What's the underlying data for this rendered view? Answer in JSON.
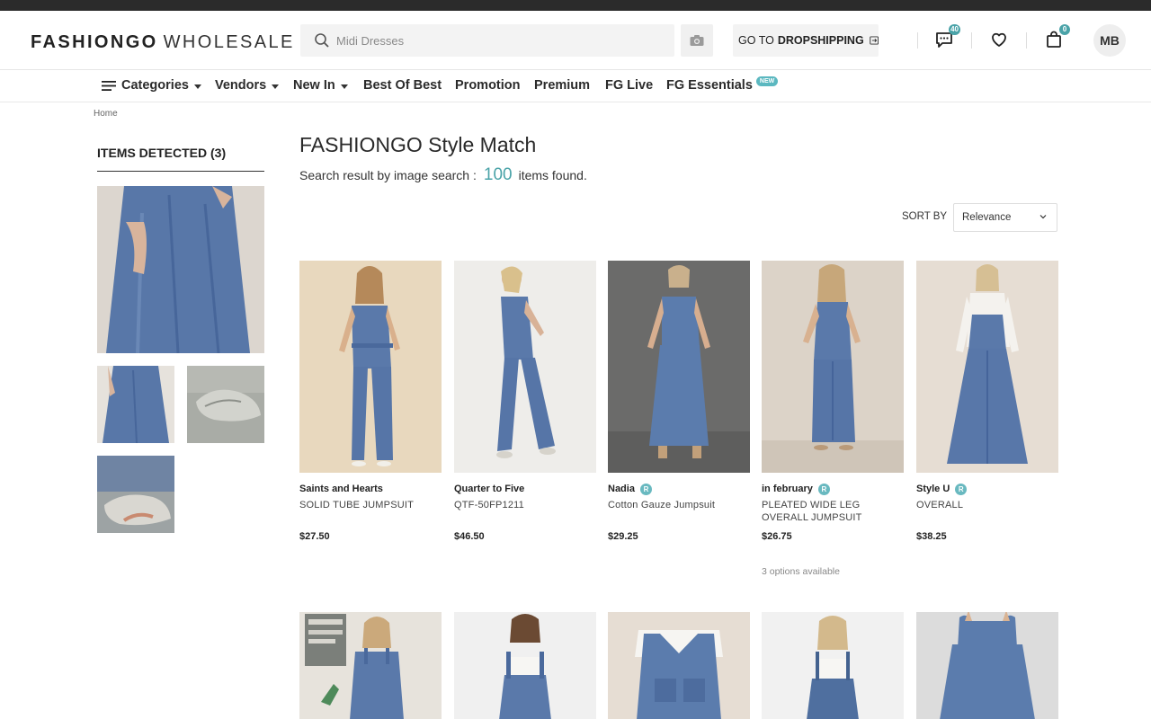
{
  "header": {
    "logo_main": "FASHIONGO",
    "logo_sub": "WHOLESALE",
    "search_placeholder": "Midi Dresses",
    "dropship_prefix": "GO TO",
    "dropship_bold": "DROPSHIPPING",
    "messages_count": "40",
    "cart_count": "0",
    "avatar_initials": "MB"
  },
  "nav": {
    "categories": "Categories",
    "vendors": "Vendors",
    "new_in": "New In",
    "best_of_best": "Best Of Best",
    "promotion": "Promotion",
    "premium": "Premium",
    "fg_live": "FG Live",
    "fg_essentials": "FG Essentials",
    "new_tag": "NEW"
  },
  "breadcrumb": "Home",
  "sidebar": {
    "title": "ITEMS DETECTED (3)"
  },
  "main": {
    "title": "FASHIONGO Style Match",
    "result_prefix": "Search result by image search :",
    "result_count": "100",
    "result_suffix": "items found.",
    "sort_label": "SORT BY",
    "sort_value": "Relevance"
  },
  "products": [
    {
      "vendor": "Saints and Hearts",
      "name": "SOLID TUBE JUMPSUIT",
      "price": "$27.50",
      "badge": ""
    },
    {
      "vendor": "Quarter to Five",
      "name": "QTF-50FP1211",
      "price": "$46.50",
      "badge": ""
    },
    {
      "vendor": "Nadia",
      "name": "Cotton Gauze Jumpsuit",
      "price": "$29.25",
      "badge": "R"
    },
    {
      "vendor": "in february",
      "name": "PLEATED WIDE LEG OVERALL JUMPSUIT",
      "price": "$26.75",
      "badge": "R",
      "options": "3 options available"
    },
    {
      "vendor": "Style U",
      "name": "OVERALL",
      "price": "$38.25",
      "badge": "R"
    }
  ],
  "colors": {
    "accent": "#4aa3a8",
    "denim": "#5a78a8",
    "topbar": "#2b2b2b"
  }
}
